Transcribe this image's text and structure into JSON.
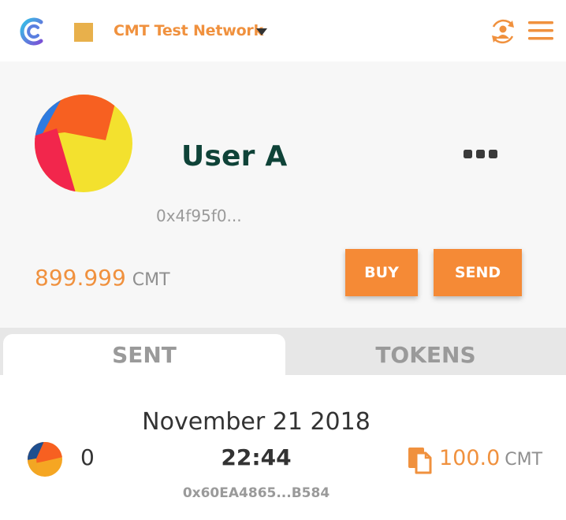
{
  "header": {
    "network_name": "CMT Test Network",
    "network_color": "#e8b04b",
    "icons": [
      "cybermiles-logo-icon",
      "network-square-icon",
      "caret-down-icon",
      "account-sync-icon",
      "hamburger-menu-icon"
    ]
  },
  "account": {
    "name": "User A",
    "address": "0x4f95f0...",
    "balance": "899.999",
    "balance_unit": "CMT",
    "buy_label": "BUY",
    "send_label": "SEND"
  },
  "tabs": [
    {
      "label": "SENT",
      "active": true
    },
    {
      "label": "TOKENS",
      "active": false
    }
  ],
  "transactions": [
    {
      "index": "0",
      "date": "November 21 2018",
      "time": "22:44",
      "hash": "0x60EA4865...B584",
      "amount": "100.0",
      "unit": "CMT"
    }
  ],
  "colors": {
    "accent": "#f58a36",
    "accent_text": "#f0913e",
    "username": "#0f4338",
    "panel_bg": "#f7f7f7",
    "tabs_bg": "#e7e7e7"
  }
}
